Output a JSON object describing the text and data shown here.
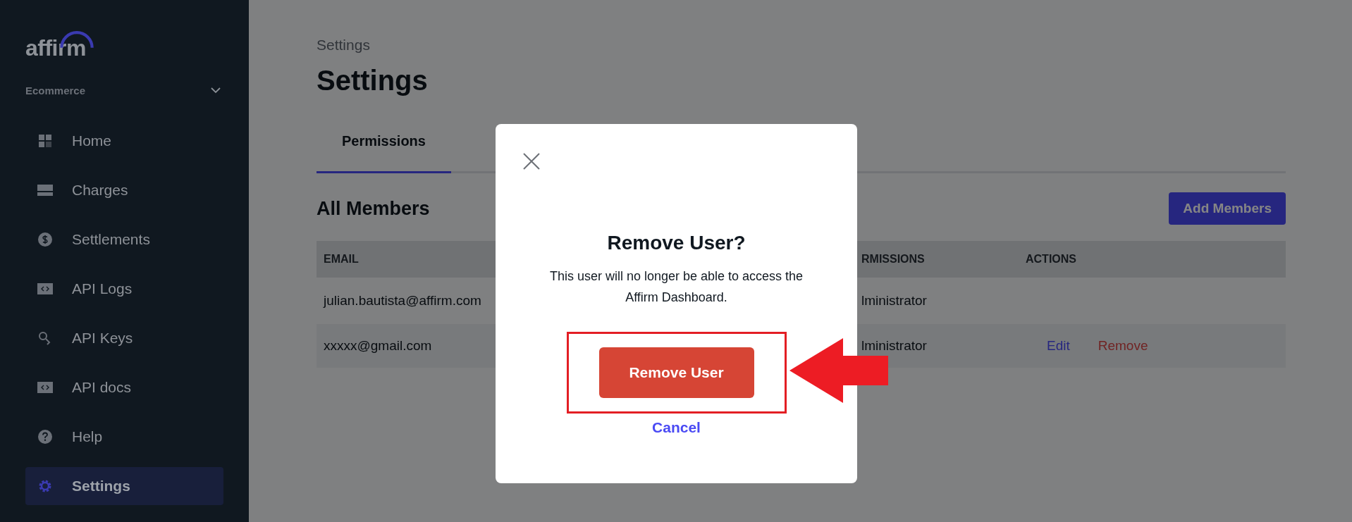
{
  "sidebar": {
    "logo": "affirm",
    "account": "Ecommerce",
    "items": [
      {
        "label": "Home",
        "kind": "grid",
        "selected": false
      },
      {
        "label": "Charges",
        "kind": "card",
        "selected": false
      },
      {
        "label": "Settlements",
        "kind": "dollar",
        "selected": false
      },
      {
        "label": "API Logs",
        "kind": "code",
        "selected": false
      },
      {
        "label": "API Keys",
        "kind": "key",
        "selected": false
      },
      {
        "label": "API docs",
        "kind": "code",
        "selected": false
      },
      {
        "label": "Help",
        "kind": "help",
        "selected": false
      },
      {
        "label": "Settings",
        "kind": "gear",
        "selected": true
      }
    ]
  },
  "header": {
    "breadcrumb": "Settings",
    "title": "Settings"
  },
  "tabs": [
    {
      "label": "Permissions",
      "selected": true
    }
  ],
  "section": {
    "title": "All Members",
    "add_button": "Add Members"
  },
  "table": {
    "columns": [
      "EMAIL",
      "RMISSIONS",
      "ACTIONS"
    ],
    "rows": [
      {
        "email": "julian.bautista@affirm.com",
        "permissions": "lministrator",
        "actions": []
      },
      {
        "email": "xxxxx@gmail.com",
        "permissions": "lministrator",
        "actions": [
          {
            "label": "Edit",
            "kind": "edit"
          },
          {
            "label": "Remove",
            "kind": "remove"
          }
        ]
      }
    ]
  },
  "modal": {
    "title": "Remove User?",
    "message_lines": [
      "This user will no longer be able to access the",
      "Affirm Dashboard."
    ],
    "confirm": "Remove User",
    "cancel": "Cancel",
    "highlighted": true
  }
}
